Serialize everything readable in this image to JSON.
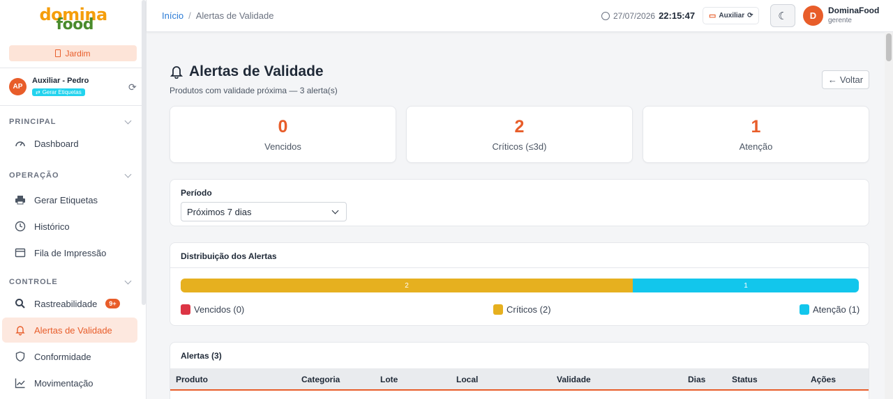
{
  "brand": {
    "line1": "domina",
    "line2": "food"
  },
  "sidebar": {
    "unit": "Jardim",
    "user": {
      "initials": "AP",
      "name": "Auxiliar - Pedro",
      "badge": "Gerar Etiquetas"
    },
    "sections": [
      {
        "title": "PRINCIPAL",
        "items": [
          {
            "label": "Dashboard",
            "icon": "gauge-icon"
          }
        ]
      },
      {
        "title": "OPERAÇÃO",
        "items": [
          {
            "label": "Gerar Etiquetas",
            "icon": "printer-icon"
          },
          {
            "label": "Histórico",
            "icon": "clock-icon"
          },
          {
            "label": "Fila de Impressão",
            "icon": "folder-icon"
          }
        ]
      },
      {
        "title": "CONTROLE",
        "items": [
          {
            "label": "Rastreabilidade",
            "icon": "search-icon",
            "badge": "9+"
          },
          {
            "label": "Alertas de Validade",
            "icon": "bell-icon",
            "active": true
          },
          {
            "label": "Conformidade",
            "icon": "shield-icon"
          },
          {
            "label": "Movimentação",
            "icon": "chart-line-icon"
          }
        ]
      }
    ]
  },
  "topbar": {
    "breadcrumb_home": "Início",
    "breadcrumb_current": "Alertas de Validade",
    "date": "27/07/2026",
    "time": "22:15:47",
    "role": "Auxiliar",
    "user_initial": "D",
    "user_name": "DominaFood",
    "user_role": "gerente"
  },
  "page": {
    "title": "Alertas de Validade",
    "subtitle": "Produtos com validade próxima — 3 alerta(s)",
    "back_label": "Voltar"
  },
  "stats": [
    {
      "value": "0",
      "label": "Vencidos"
    },
    {
      "value": "2",
      "label": "Críticos (≤3d)"
    },
    {
      "value": "1",
      "label": "Atenção"
    }
  ],
  "filter": {
    "label": "Período",
    "selected": "Próximos 7 dias"
  },
  "distribution": {
    "title": "Distribuição dos Alertas",
    "segments": [
      {
        "name": "Vencidos",
        "count": 0,
        "color": "#dc3545"
      },
      {
        "name": "Críticos",
        "count": 2,
        "color": "#e6b01f"
      },
      {
        "name": "Atenção",
        "count": 1,
        "color": "#12c6ec"
      }
    ],
    "legend": [
      "Vencidos (0)",
      "Críticos (2)",
      "Atenção (1)"
    ]
  },
  "alerts": {
    "title": "Alertas (3)",
    "columns": [
      "Produto",
      "Categoria",
      "Lote",
      "Local",
      "Validade",
      "Dias",
      "Status",
      "Ações"
    ]
  },
  "colors": {
    "accent": "#e85d2a",
    "link": "#2b7bd6"
  }
}
